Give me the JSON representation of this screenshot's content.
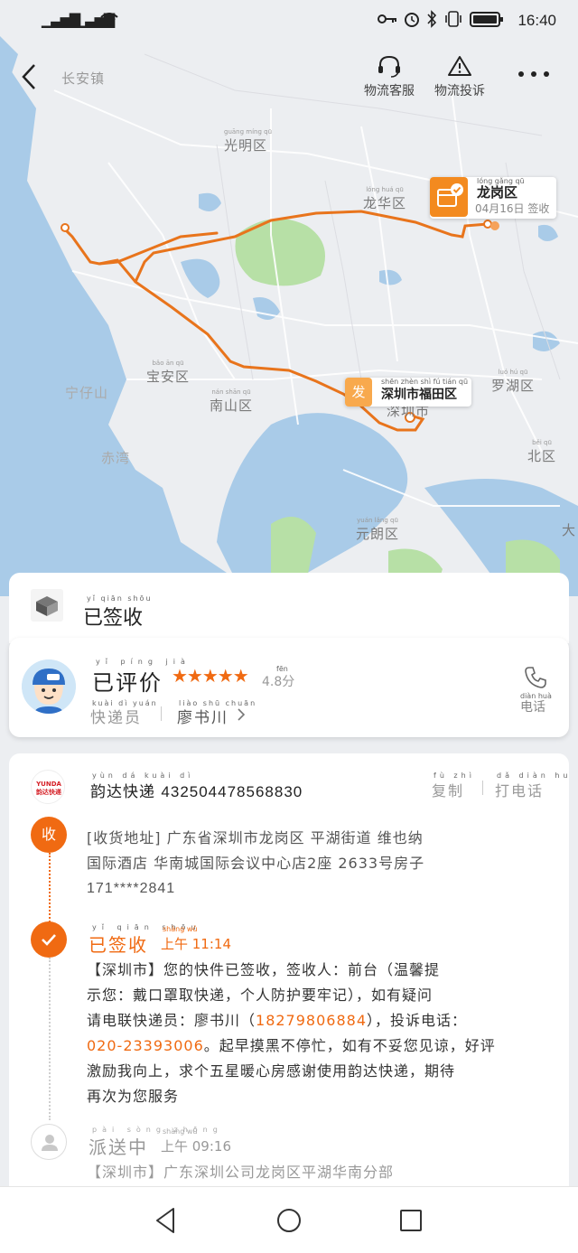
{
  "statusbar": {
    "time": "16:40"
  },
  "topbar": {
    "service_label": "物流客服",
    "complaint_label": "物流投诉"
  },
  "map": {
    "labels": {
      "changan": "长安镇",
      "guangming": "光明区",
      "longhua": "龙华区",
      "baoan": "宝安区",
      "nanshan": "南山区",
      "luohu": "罗湖区",
      "shenzhen": "深圳市",
      "yuanlang": "元朗区",
      "beiqu": "北区",
      "qianhai": "宁仔山",
      "chiwan": "赤湾",
      "da": "大"
    },
    "pinyin": {
      "guangming": "guāng míng qū",
      "longhua": "lóng huá qū",
      "baoan": "bǎo ān qū",
      "nanshan": "nán shān qū",
      "luohu": "luó hú qū",
      "yuanlang": "yuán lǎng qū",
      "beiqu": "běi qū"
    },
    "dest_marker": {
      "title": "龙岗区",
      "pinyin": "lóng gǎng qū",
      "sub": "04月16日 签收"
    },
    "src_marker": {
      "badge": "发",
      "title": "深圳市福田区",
      "pinyin": "shēn zhèn shì fú tián qū"
    }
  },
  "status": {
    "label": "已签收",
    "pinyin": "yǐ qiān shōu"
  },
  "courier": {
    "eval_label": "已评价",
    "eval_pinyin": "yǐ píng jià",
    "stars": "★★★★★",
    "score": "4.8分",
    "score_pinyin": "fēn",
    "role": "快递员",
    "role_pinyin": "kuài dì yuán",
    "name": "廖书川",
    "name_pinyin": "liào shū chuān",
    "call_label": "电话",
    "call_pinyin": "diàn huà"
  },
  "tracking": {
    "logo_text": "YUNDA 韵达快递",
    "carrier": "韵达快递",
    "carrier_pinyin": "yùn dá kuài dì",
    "number": "432504478568830",
    "copy_label": "复制",
    "copy_pinyin": "fù zhì",
    "phone_label": "打电话",
    "phone_pinyin": "dǎ diàn huà",
    "receive_badge": "收",
    "address_lines": [
      "[收货地址] 广东省深圳市龙岗区 平湖街道  维也纳",
      "国际酒店  华南城国际会议中心店2座  2633号房子",
      "171****2841"
    ],
    "events": [
      {
        "title": "已签收",
        "title_pinyin": "yǐ qiān shōu",
        "time": "上午 11:14",
        "time_pinyin": "shàng wǔ",
        "desc_1": "【深圳市】您的快件已签收，签收人：前台（温馨提",
        "desc_2": "示您：戴口罩取快递，个人防护要牢记），如有疑问",
        "desc_3a": "请电联快递员：廖书川（",
        "desc_3b": "18279806884",
        "desc_3c": "），投诉电话：",
        "desc_4a": "020-23393006",
        "desc_4b": "。起早摸黑不停忙，如有不妥您见谅，好评",
        "desc_5": "激励我向上，求个五星暖心房感谢使用韵达快递，期待",
        "desc_6": "再次为您服务"
      },
      {
        "title": "派送中",
        "title_pinyin": "pài sòng zhōng",
        "time": "上午 09:16",
        "time_pinyin": "shàng wǔ",
        "desc_1": "【深圳市】广东深圳公司龙岗区平湖华南分部"
      }
    ]
  },
  "colors": {
    "accent": "#f06a12",
    "route": "#e8741c",
    "water": "#a9cbe8",
    "green": "#b7e0a6"
  }
}
